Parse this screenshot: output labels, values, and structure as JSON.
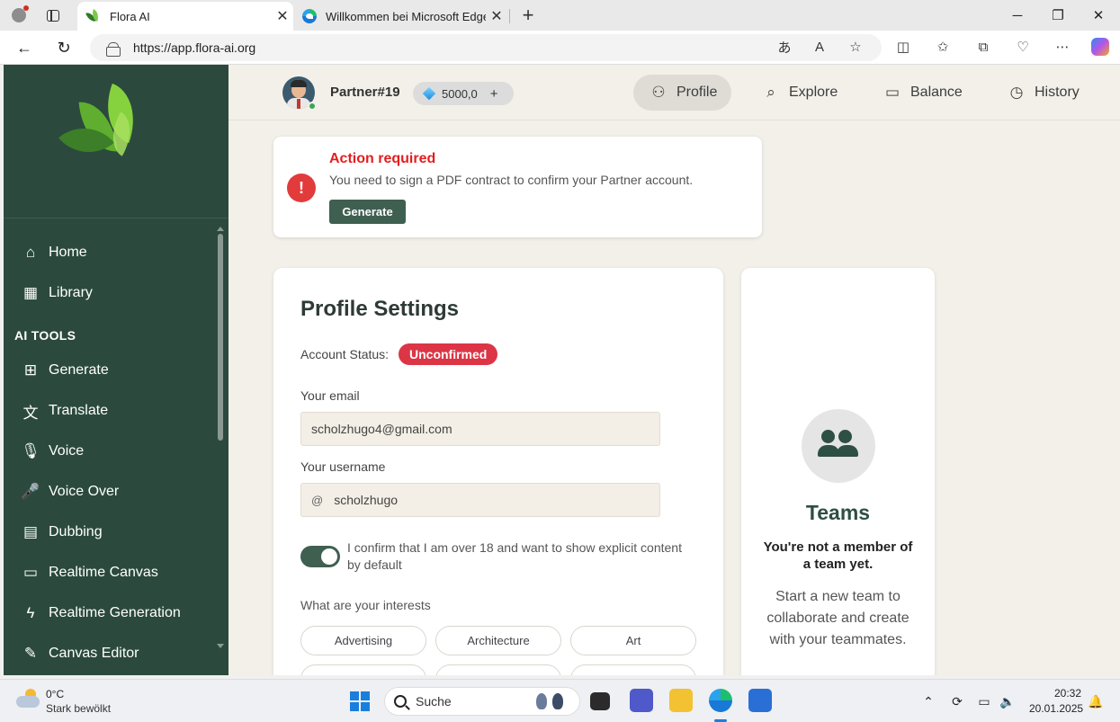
{
  "browser": {
    "tabs": [
      {
        "title": "Flora AI",
        "active": true
      },
      {
        "title": "Willkommen bei Microsoft Edge",
        "active": false
      }
    ],
    "url": "https://app.flora-ai.org"
  },
  "sidebar": {
    "items_top": [
      {
        "label": "Home",
        "icon": "home-icon"
      },
      {
        "label": "Library",
        "icon": "grid-icon"
      }
    ],
    "section_heading": "AI TOOLS",
    "tools": [
      {
        "label": "Generate",
        "icon": "plus-file-icon"
      },
      {
        "label": "Translate",
        "icon": "translate-icon"
      },
      {
        "label": "Voice",
        "icon": "microphone-icon"
      },
      {
        "label": "Voice Over",
        "icon": "microphone-filled-icon"
      },
      {
        "label": "Dubbing",
        "icon": "film-icon"
      },
      {
        "label": "Realtime Canvas",
        "icon": "monitor-icon"
      },
      {
        "label": "Realtime Generation",
        "icon": "bolt-icon"
      },
      {
        "label": "Canvas Editor",
        "icon": "edit-icon"
      }
    ]
  },
  "header": {
    "username": "Partner#19",
    "balance": "5000,0",
    "balance_plus": "+",
    "nav": [
      {
        "label": "Profile",
        "icon": "user-icon",
        "active": true
      },
      {
        "label": "Explore",
        "icon": "search-icon",
        "active": false
      },
      {
        "label": "Balance",
        "icon": "wallet-icon",
        "active": false
      },
      {
        "label": "History",
        "icon": "clock-icon",
        "active": false
      }
    ]
  },
  "action": {
    "title": "Action required",
    "message": "You need to sign a PDF contract to confirm your Partner account.",
    "button": "Generate"
  },
  "profile": {
    "title": "Profile Settings",
    "status_label": "Account Status:",
    "status_value": "Unconfirmed",
    "email_label": "Your email",
    "email_value": "scholzhugo4@gmail.com",
    "username_label": "Your username",
    "username_prefix": "@",
    "username_value": "scholzhugo",
    "explicit_toggle_on": true,
    "explicit_text": "I confirm that I am over 18 and want to show explicit content by default",
    "interests_label": "What are your interests",
    "interests": [
      "Advertising",
      "Architecture",
      "Art"
    ]
  },
  "teams": {
    "title": "Teams",
    "subtitle": "You're not a member of a team yet.",
    "description": "Start a new team to collaborate and create with your teammates."
  },
  "taskbar": {
    "temperature": "0°C",
    "weather": "Stark bewölkt",
    "search_placeholder": "Suche",
    "time": "20:32",
    "date": "20.01.2025"
  },
  "colors": {
    "sidebar_bg": "#2b4a3d",
    "content_bg": "#f2f0e9",
    "accent_green": "#3f5f51",
    "alert_red": "#e31e1e",
    "badge_red": "#dc3545"
  }
}
